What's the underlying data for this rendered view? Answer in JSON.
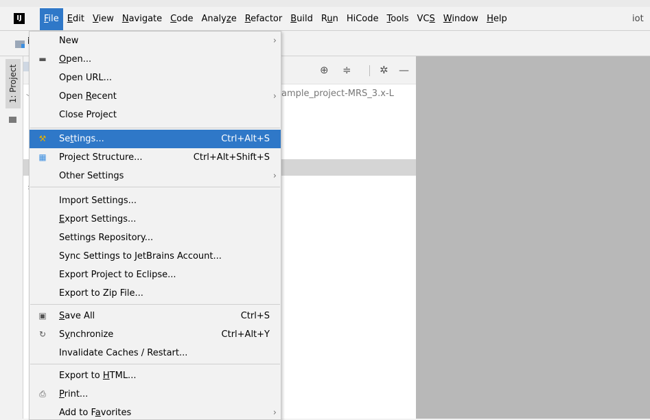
{
  "menubar": {
    "app_logo_text": "IJ",
    "items": [
      {
        "pre": "",
        "mn": "F",
        "post": "ile",
        "active": true
      },
      {
        "pre": "",
        "mn": "E",
        "post": "dit"
      },
      {
        "pre": "",
        "mn": "V",
        "post": "iew"
      },
      {
        "pre": "",
        "mn": "N",
        "post": "avigate"
      },
      {
        "pre": "",
        "mn": "C",
        "post": "ode"
      },
      {
        "pre": "Analy",
        "mn": "z",
        "post": "e"
      },
      {
        "pre": "",
        "mn": "R",
        "post": "efactor"
      },
      {
        "pre": "",
        "mn": "B",
        "post": "uild"
      },
      {
        "pre": "R",
        "mn": "u",
        "post": "n"
      },
      {
        "pre": "HiCode",
        "mn": "",
        "post": ""
      },
      {
        "pre": "",
        "mn": "T",
        "post": "ools"
      },
      {
        "pre": "VC",
        "mn": "S",
        "post": ""
      },
      {
        "pre": "",
        "mn": "W",
        "post": "indow"
      },
      {
        "pre": "",
        "mn": "H",
        "post": "elp"
      }
    ],
    "project_name": "iot"
  },
  "navbar": {
    "text": "i"
  },
  "sidebar": {
    "project_tab_label": "1: Project"
  },
  "project_panel": {
    "path_text": "ample_project-MRS_3.x-L",
    "toolbar_icons": [
      "locate-icon",
      "collapse-icon",
      "gear-icon",
      "minimize-icon"
    ]
  },
  "file_menu": {
    "items": [
      {
        "pre": "New",
        "mn": "",
        "post": "",
        "shortcut": "",
        "submenu": true,
        "icon": ""
      },
      {
        "pre": "",
        "mn": "O",
        "post": "pen...",
        "shortcut": "",
        "submenu": false,
        "icon": "folder-open-icon"
      },
      {
        "pre": "Open URL...",
        "mn": "",
        "post": "",
        "shortcut": "",
        "submenu": false,
        "icon": ""
      },
      {
        "pre": "Open ",
        "mn": "R",
        "post": "ecent",
        "shortcut": "",
        "submenu": true,
        "icon": ""
      },
      {
        "pre": "Close Project",
        "mn": "",
        "post": "",
        "shortcut": "",
        "submenu": false,
        "icon": ""
      },
      {
        "pre": "Se",
        "mn": "t",
        "post": "tings...",
        "shortcut": "Ctrl+Alt+S",
        "submenu": false,
        "icon": "wrench-icon",
        "selected": true
      },
      {
        "pre": "Project Structure...",
        "mn": "",
        "post": "",
        "shortcut": "Ctrl+Alt+Shift+S",
        "submenu": false,
        "icon": "project-structure-icon"
      },
      {
        "pre": "Other Settings",
        "mn": "",
        "post": "",
        "shortcut": "",
        "submenu": true,
        "icon": ""
      },
      {
        "pre": "Import Settings...",
        "mn": "",
        "post": "",
        "shortcut": "",
        "submenu": false,
        "icon": ""
      },
      {
        "pre": "",
        "mn": "E",
        "post": "xport Settings...",
        "shortcut": "",
        "submenu": false,
        "icon": ""
      },
      {
        "pre": "Settings Repository...",
        "mn": "",
        "post": "",
        "shortcut": "",
        "submenu": false,
        "icon": ""
      },
      {
        "pre": "Sync Settings to JetBrains Account...",
        "mn": "",
        "post": "",
        "shortcut": "",
        "submenu": false,
        "icon": ""
      },
      {
        "pre": "Export Project to Eclipse...",
        "mn": "",
        "post": "",
        "shortcut": "",
        "submenu": false,
        "icon": ""
      },
      {
        "pre": "Export to Zip File...",
        "mn": "",
        "post": "",
        "shortcut": "",
        "submenu": false,
        "icon": ""
      },
      {
        "pre": "",
        "mn": "S",
        "post": "ave All",
        "shortcut": "Ctrl+S",
        "submenu": false,
        "icon": "save-icon"
      },
      {
        "pre": "S",
        "mn": "y",
        "post": "nchronize",
        "shortcut": "Ctrl+Alt+Y",
        "submenu": false,
        "icon": "sync-icon"
      },
      {
        "pre": "Invalidate Caches / Restart...",
        "mn": "",
        "post": "",
        "shortcut": "",
        "submenu": false,
        "icon": ""
      },
      {
        "pre": "Export to ",
        "mn": "H",
        "post": "TML...",
        "shortcut": "",
        "submenu": false,
        "icon": ""
      },
      {
        "pre": "",
        "mn": "P",
        "post": "rint...",
        "shortcut": "",
        "submenu": false,
        "icon": "print-icon"
      },
      {
        "pre": "Add to F",
        "mn": "a",
        "post": "vorites",
        "shortcut": "",
        "submenu": true,
        "icon": ""
      }
    ]
  },
  "colors": {
    "accent": "#2f78c8",
    "editor_bg": "#b8b8b8",
    "menu_bg": "#f2f2f2"
  }
}
